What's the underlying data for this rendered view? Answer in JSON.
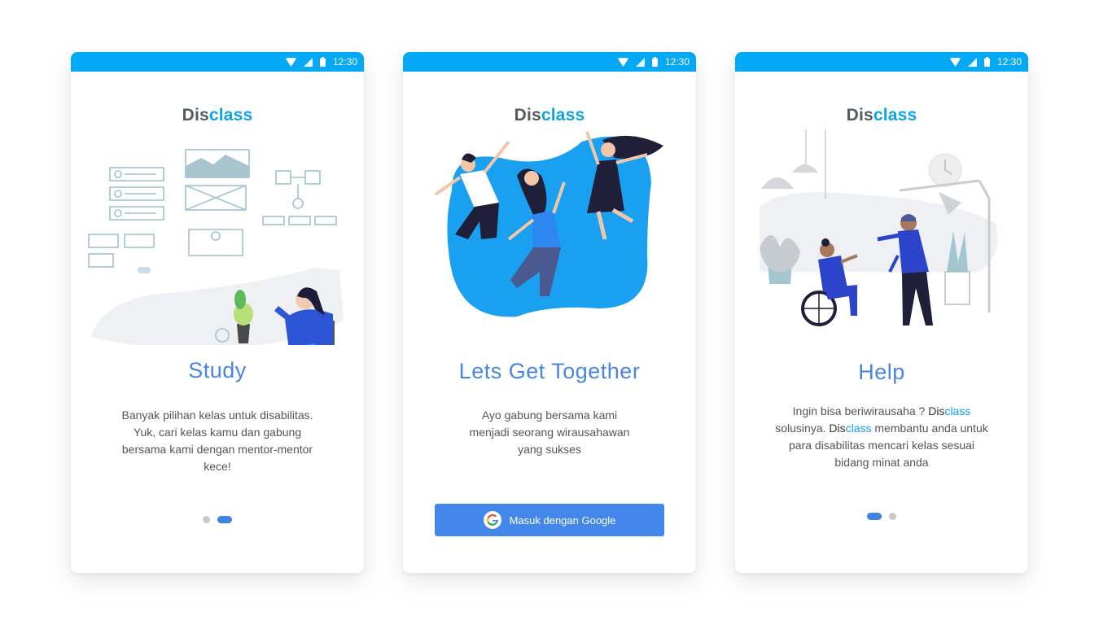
{
  "status_bar": {
    "time": "12:30"
  },
  "brand": {
    "part1": "Dis",
    "part2": "class",
    "color_dark": "#555a5f",
    "color_accent": "#0aa4e8"
  },
  "screens": [
    {
      "title": "Study",
      "description": [
        "Banyak pilihan kelas untuk disabilitas.",
        "Yuk, cari kelas kamu dan gabung",
        "bersama kami dengan mentor-mentor",
        "kece!"
      ],
      "pager": {
        "active_index": 1,
        "count": 2
      }
    },
    {
      "title": "Lets Get Together",
      "description": [
        "Ayo gabung bersama kami",
        "menjadi seorang wirausahawan",
        "yang sukses"
      ],
      "button": {
        "label": "Masuk dengan Google",
        "icon": "google-icon"
      }
    },
    {
      "title": "Help",
      "description": {
        "line1_pre": "Ingin bisa beriwirausaha ? ",
        "line2_pre": "solusinya. ",
        "line2_post": " membantu anda untuk",
        "line3": "para disabilitas mencari kelas sesuai",
        "line4": "bidang minat anda"
      },
      "pager": {
        "active_index": 0,
        "count": 2
      }
    }
  ],
  "colors": {
    "status_bar": "#03a9f4",
    "title": "#4a86e0",
    "button": "#4387ea",
    "dot_active": "#3f84e5",
    "dot_inactive": "#c8c8c8"
  }
}
